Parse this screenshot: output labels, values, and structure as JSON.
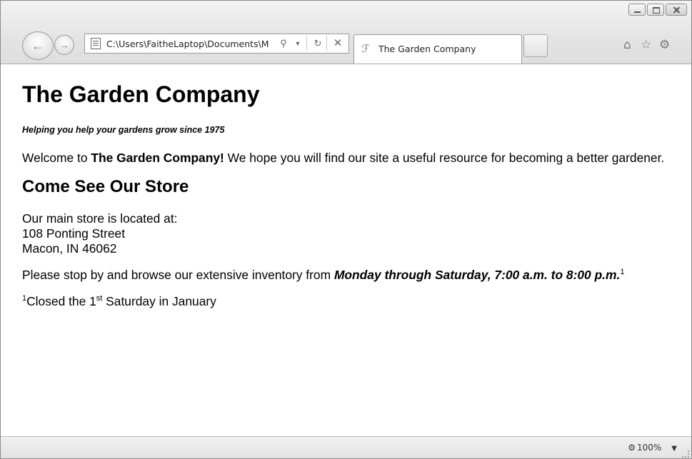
{
  "browser": {
    "address_url": "C:\\Users\\FaitheLaptop\\Documents\\M",
    "tab_title": "The Garden Company",
    "zoom_level": "100%",
    "icons": [
      "back-icon",
      "forward-icon",
      "page-icon",
      "search-icon",
      "dropdown-icon",
      "refresh-icon",
      "stop-icon",
      "ie-icon",
      "home-icon",
      "favorites-icon",
      "tools-icon",
      "zoom-icon"
    ]
  },
  "page": {
    "heading": "The Garden Company",
    "tagline": "Helping you help your gardens grow since 1975",
    "welcome_prefix": "Welcome to ",
    "welcome_bold": "The Garden Company!",
    "welcome_suffix": " We hope you will find our site a useful resource for becoming a better gardener.",
    "store_heading": "Come See Our Store",
    "store_line1": "Our main store is located at:",
    "store_line2": "108 Ponting Street",
    "store_line3": "Macon, IN 46062",
    "hours_prefix": "Please stop by and browse our extensive inventory from ",
    "hours_bold": "Monday through Saturday, 7:00 a.m. to 8:00 p.m.",
    "hours_footnote_mark": "1",
    "footnote_mark": "1",
    "footnote_text_a": "Closed the 1",
    "footnote_sup": "st",
    "footnote_text_b": " Saturday in January"
  }
}
